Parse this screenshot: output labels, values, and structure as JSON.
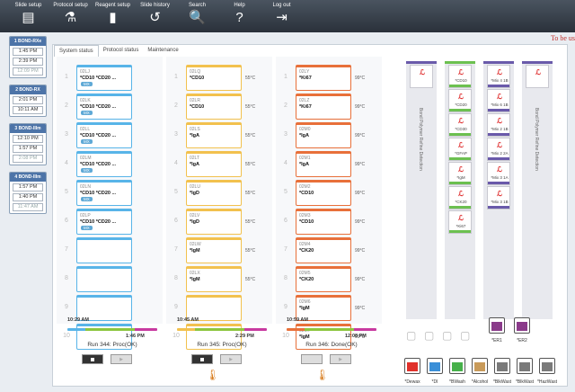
{
  "toolbar": {
    "items": [
      {
        "label": "Slide setup",
        "icon": "slide-setup-icon",
        "glyph": "▤"
      },
      {
        "label": "Protocol setup",
        "icon": "protocol-setup-icon",
        "glyph": "⚗"
      },
      {
        "label": "Reagent setup",
        "icon": "reagent-setup-icon",
        "glyph": "▮"
      },
      {
        "label": "Slide history",
        "icon": "slide-history-icon",
        "glyph": "↺"
      },
      {
        "label": "Search",
        "icon": "search-icon",
        "glyph": "🔍"
      },
      {
        "label": "Help",
        "icon": "help-icon",
        "glyph": "?"
      },
      {
        "label": "Log out",
        "icon": "log-out-icon",
        "glyph": "⇥"
      }
    ]
  },
  "banner": "To be us",
  "tabs": [
    "System status",
    "Protocol status",
    "Maintenance"
  ],
  "sidebar": [
    {
      "title": "1 BOND-RXe",
      "times": [
        "1:45 PM",
        "2:39 PM",
        "12:09 PM"
      ]
    },
    {
      "title": "2 BOND-RX",
      "times": [
        "2:01 PM",
        "10:11 AM"
      ]
    },
    {
      "title": "3 BOND-IIIm",
      "times": [
        "12:10 PM",
        "1:57 PM",
        "2:08 PM"
      ]
    },
    {
      "title": "4 BOND-IIIm",
      "times": [
        "1:57 PM",
        "1:40 PM",
        "11:47 AM"
      ]
    }
  ],
  "run1": {
    "slides": [
      {
        "id": "02LJ",
        "marker": "*CD10 *CD20 ...",
        "badge": "MX"
      },
      {
        "id": "02LK",
        "marker": "*CD10 *CD20 ...",
        "badge": "MX"
      },
      {
        "id": "02LL",
        "marker": "*CD10 *CD20 ...",
        "badge": "MX"
      },
      {
        "id": "02LM",
        "marker": "*CD10 *CD20 ...",
        "badge": "MX"
      },
      {
        "id": "02LN",
        "marker": "*CD10 *CD20 ...",
        "badge": "MX"
      },
      {
        "id": "02LP",
        "marker": "*CD10 *CD20 ...",
        "badge": "MX"
      }
    ],
    "start": "10:29 AM",
    "end": "1:46 PM",
    "status": "Run 344: Proc(OK)"
  },
  "run2": {
    "slides": [
      {
        "id": "02LQ",
        "marker": "*CD10",
        "temp": "55°C"
      },
      {
        "id": "02LR",
        "marker": "*CD10",
        "temp": "55°C"
      },
      {
        "id": "02LS",
        "marker": "*IgA",
        "temp": "55°C"
      },
      {
        "id": "02LT",
        "marker": "*IgA",
        "temp": "55°C"
      },
      {
        "id": "02LU",
        "marker": "*IgD",
        "temp": "55°C"
      },
      {
        "id": "02LV",
        "marker": "*IgD",
        "temp": "55°C"
      },
      {
        "id": "02LW",
        "marker": "*IgM",
        "temp": "55°C"
      },
      {
        "id": "02LX",
        "marker": "*IgM",
        "temp": "55°C"
      }
    ],
    "start": "10:45 AM",
    "end": "2:29 PM",
    "status": "Run 345: Proc(OK)"
  },
  "run3": {
    "slides": [
      {
        "id": "02LY",
        "marker": "*Ki67",
        "temp": "99°C"
      },
      {
        "id": "02LZ",
        "marker": "*Ki67",
        "temp": "99°C"
      },
      {
        "id": "02M0",
        "marker": "*IgA",
        "temp": "99°C"
      },
      {
        "id": "02M1",
        "marker": "*IgA",
        "temp": "99°C"
      },
      {
        "id": "02M2",
        "marker": "*CD10",
        "temp": "99°C"
      },
      {
        "id": "02M3",
        "marker": "*CD10",
        "temp": "99°C"
      },
      {
        "id": "02M4",
        "marker": "*CK20",
        "temp": "99°C"
      },
      {
        "id": "02M5",
        "marker": "*CK20",
        "temp": "99°C"
      },
      {
        "id": "02M6",
        "marker": "*IgM",
        "temp": "99°C"
      },
      {
        "id": "02M7",
        "marker": "*IgM",
        "temp": "99°C"
      }
    ],
    "start": "10:59 AM",
    "end": "12:08 PM",
    "status": "Run 346: Done(OK)"
  },
  "reagents": {
    "col1_label": "Bond Polymer Refine Detection",
    "col2": [
      "*CD10",
      "*CD20",
      "*CD30",
      "*GFAP",
      "*IgM",
      "*CK20",
      "*Ki67"
    ],
    "col3": [
      "*Mix 4 1B",
      "*Mix 6 1B",
      "*Mix 2 1B",
      "*Mix 2 2A",
      "*Mix 3 1A",
      "*Mix 3 1B"
    ],
    "col4_label": "Bond Polymer Refine Detection"
  },
  "bulk": {
    "small": [
      "*ER1",
      "*ER2"
    ],
    "bottles": [
      {
        "label": "*Dewax",
        "color": "#e0302a"
      },
      {
        "label": "*DI",
        "color": "#3a8fd8"
      },
      {
        "label": "*BWash",
        "color": "#46b04a"
      },
      {
        "label": "*Alcohol",
        "color": "#c89a5a"
      },
      {
        "label": "*BlkWast",
        "color": "#7a7a7a"
      },
      {
        "label": "*BlkWast",
        "color": "#7a7a7a"
      },
      {
        "label": "*HazWast",
        "color": "#7a7a7a"
      }
    ]
  },
  "colors": {
    "blue": "#58b4e8",
    "yellow": "#f2c14e",
    "orange": "#e8703a",
    "green": "#6cc050",
    "purple": "#6a5aaa"
  }
}
